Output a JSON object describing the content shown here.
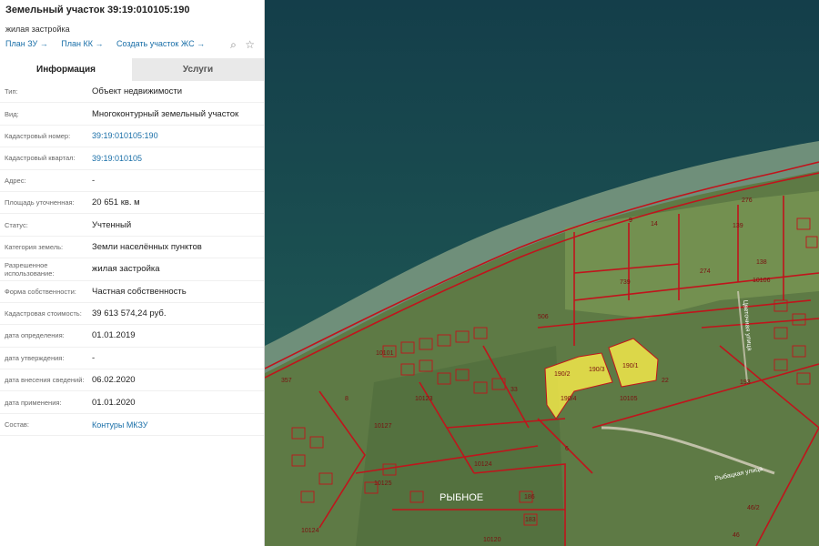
{
  "header": {
    "title": "Земельный участок 39:19:010105:190",
    "subtitle": "жилая застройка",
    "links": [
      "План ЗУ",
      "План КК",
      "Создать участок ЖС"
    ],
    "arrow": "→"
  },
  "tabs": [
    {
      "label": "Информация",
      "active": true
    },
    {
      "label": "Услуги",
      "active": false
    }
  ],
  "info": [
    {
      "key": "Тип:",
      "value": "Объект недвижимости"
    },
    {
      "key": "Вид:",
      "value": "Многоконтурный земельный участок"
    },
    {
      "key": "Кадастровый номер:",
      "value": "39:19:010105:190",
      "link": true
    },
    {
      "key": "Кадастровый квартал:",
      "value": "39:19:010105",
      "link": true
    },
    {
      "key": "Адрес:",
      "value": "-"
    },
    {
      "key": "Площадь уточненная:",
      "value": "20 651 кв. м"
    },
    {
      "key": "Статус:",
      "value": "Учтенный"
    },
    {
      "key": "Категория земель:",
      "value": "Земли населённых пунктов"
    },
    {
      "key": "Разрешенное использование:",
      "value": "жилая застройка"
    },
    {
      "key": "Форма собственности:",
      "value": "Частная собственность"
    },
    {
      "key": "Кадастровая стоимость:",
      "value": "39 613 574,24 руб."
    },
    {
      "key": "дата определения:",
      "value": "01.01.2019"
    },
    {
      "key": "дата утверждения:",
      "value": "-"
    },
    {
      "key": "дата внесения сведений:",
      "value": "06.02.2020"
    },
    {
      "key": "дата применения:",
      "value": "01.01.2020"
    },
    {
      "key": "Состав:",
      "value": "Контуры МКЗУ",
      "link": true
    }
  ],
  "map": {
    "town_label": "РЫБНОЕ",
    "street_labels": [
      "Рыбацкая улица",
      "Цветочная улица"
    ],
    "parcel_labels": [
      "276",
      "139",
      "9",
      "14",
      "138",
      "274",
      "739",
      "10106",
      "506",
      "10101",
      "10105",
      "10123",
      "10124",
      "10125",
      "10127",
      "357",
      "190/1",
      "190/2",
      "190/3",
      "190/4",
      "193",
      "6",
      "8",
      "46",
      "46/2",
      "33",
      "22",
      "186",
      "183",
      "10120",
      "10124"
    ],
    "colors": {
      "sea": "#1f5a57",
      "shore": "#6f8f7a",
      "land": "#5e7a45",
      "boundary": "#c0141c",
      "highlight": "#f2e84a"
    },
    "icons": {
      "zoom": "search-doc-icon",
      "fav": "star-icon"
    }
  }
}
